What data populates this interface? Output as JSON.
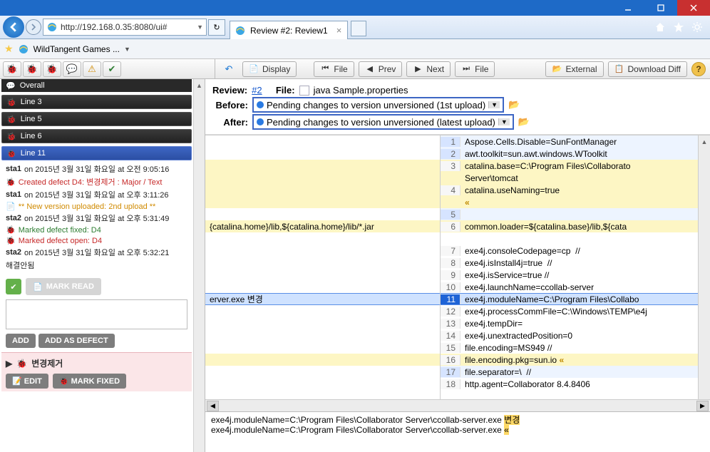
{
  "window": {
    "url_display": "http://192.168.0.35:8080/ui#",
    "tab_title": "Review #2: Review1",
    "fav_label": "WildTangent Games ..."
  },
  "toolbar": {
    "display": "Display",
    "file_left": "File",
    "prev": "Prev",
    "next": "Next",
    "file_right": "File",
    "external": "External",
    "download": "Download Diff"
  },
  "review": {
    "label": "Review:",
    "num": "#2",
    "file_label": "File:",
    "file_name": "java Sample.properties",
    "before_label": "Before:",
    "before_val": "Pending changes to version unversioned (1st upload)",
    "after_label": "After:",
    "after_val": "Pending changes to version unversioned (latest upload)"
  },
  "sidebar": {
    "overall": "Overall",
    "lines": [
      "Line 3",
      "Line 5",
      "Line 6",
      "Line 11"
    ],
    "d_user1": "sta1",
    "d_time1": "on 2015년 3월 31일 화요일 at 오전 9:05:16",
    "d_created": "Created defect D4: 변경제거 : Major / Text",
    "d_user1b": "sta1",
    "d_time1b": "on 2015년 3월 31일 화요일 at 오후 3:11:26",
    "d_upload": "** New version uploaded: 2nd upload **",
    "d_user2": "sta2",
    "d_time2": "on 2015년 3월 31일 화요일 at 오후 5:31:49",
    "d_fixed": "Marked defect fixed: D4",
    "d_open": "Marked defect open: D4",
    "d_user2b": "sta2",
    "d_time2b": "on 2015년 3월 31일 화요일 at 오후 5:32:21",
    "d_unresolved": "해결안됨",
    "mark_read": "MARK READ",
    "add": "ADD",
    "add_defect": "ADD AS DEFECT",
    "defect_name": "변경제거",
    "edit": "EDIT",
    "mark_fixed": "MARK FIXED"
  },
  "code_left": {
    "r11": "erver.exe 변경",
    "r6": "{catalina.home}/lib,${catalina.home}/lib/*.jar"
  },
  "code_right": [
    {
      "n": "1",
      "cls": "row-blue",
      "t": "Aspose.Cells.Disable=SunFontManager"
    },
    {
      "n": "2",
      "cls": "row-blue",
      "t": "awt.toolkit=sun.awt.windows.WToolkit"
    },
    {
      "n": "3",
      "cls": "row-ylw",
      "t": "catalina.base=C:\\Program Files\\Collaborato"
    },
    {
      "n": "",
      "cls": "row-ylw",
      "t": "Server\\tomcat"
    },
    {
      "n": "4",
      "cls": "row-ylw",
      "t": "catalina.useNaming=true"
    },
    {
      "n": "",
      "cls": "row-ylw",
      "t": "«",
      "gold": true
    },
    {
      "n": "5",
      "cls": "row-blue",
      "t": ""
    },
    {
      "n": "6",
      "cls": "row-ylw",
      "t": "common.loader=${catalina.base}/lib,${cata"
    },
    {
      "n": "",
      "cls": "row-default",
      "t": ""
    },
    {
      "n": "7",
      "cls": "row-default",
      "t": "exe4j.consoleCodepage=cp  //"
    },
    {
      "n": "8",
      "cls": "row-default",
      "t": "exe4j.isInstall4j=true  //"
    },
    {
      "n": "9",
      "cls": "row-default",
      "t": "exe4j.isService=true //"
    },
    {
      "n": "10",
      "cls": "row-default",
      "t": "exe4j.launchName=ccollab-server"
    },
    {
      "n": "11",
      "cls": "row-sel",
      "t": "exe4j.moduleName=C:\\Program Files\\Collabo",
      "sel": true
    },
    {
      "n": "12",
      "cls": "row-default",
      "t": "exe4j.processCommFile=C:\\Windows\\TEMP\\e4j"
    },
    {
      "n": "13",
      "cls": "row-default",
      "t": "exe4j.tempDir="
    },
    {
      "n": "14",
      "cls": "row-default",
      "t": "exe4j.unextractedPosition=0"
    },
    {
      "n": "15",
      "cls": "row-default",
      "t": "file.encoding=MS949 //"
    },
    {
      "n": "16",
      "cls": "row-ylw",
      "t": "file.encoding.pkg=sun.io «",
      "gold16": true
    },
    {
      "n": "17",
      "cls": "row-blue",
      "t": "file.separator=\\  //"
    },
    {
      "n": "18",
      "cls": "row-default",
      "t": "http.agent=Collaborator 8.4.8406"
    }
  ],
  "bottom": {
    "l1_pre": "exe4j.moduleName=C:\\Program Files\\Collaborator Server\\ccollab-server.exe ",
    "l1_hl": "변경",
    "l2_pre": "exe4j.moduleName=C:\\Program Files\\Collaborator Server\\ccollab-server.exe ",
    "l2_hl": "«"
  }
}
